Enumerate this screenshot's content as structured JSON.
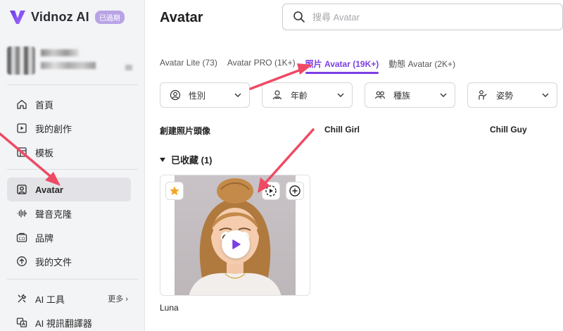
{
  "brand": {
    "name": "Vidnoz AI",
    "badge": "已過期"
  },
  "sidebar": {
    "items": [
      {
        "label": "首頁",
        "icon": "home-icon"
      },
      {
        "label": "我的創作",
        "icon": "play-square-icon"
      },
      {
        "label": "模板",
        "icon": "template-icon"
      },
      {
        "label": "Avatar",
        "icon": "avatar-icon"
      },
      {
        "label": "聲音克隆",
        "icon": "waveform-icon"
      },
      {
        "label": "品牌",
        "icon": "brand-icon"
      },
      {
        "label": "我的文件",
        "icon": "upload-icon"
      },
      {
        "label": "AI 工具",
        "icon": "tools-icon",
        "more": "更多"
      },
      {
        "label": "AI 視訊翻譯器",
        "icon": "translate-icon"
      }
    ]
  },
  "header": {
    "title": "Avatar",
    "search_placeholder": "搜尋 Avatar"
  },
  "tabs": [
    {
      "label": "Avatar Lite (73)"
    },
    {
      "label": "Avatar PRO (1K+)"
    },
    {
      "label": "照片 Avatar (19K+)",
      "active": true
    },
    {
      "label": "動態 Avatar (2K+)"
    }
  ],
  "filters": [
    {
      "label": "性別",
      "icon": "gender-icon"
    },
    {
      "label": "年齡",
      "icon": "age-icon"
    },
    {
      "label": "種族",
      "icon": "ethnicity-icon"
    },
    {
      "label": "姿勢",
      "icon": "pose-icon"
    }
  ],
  "labels": {
    "create": "創建照片頭像",
    "girl": "Chill Girl",
    "guy": "Chill Guy"
  },
  "favorites": {
    "heading": "已收藏 (1)"
  },
  "card": {
    "name": "Luna"
  },
  "colors": {
    "accent": "#7b3fe4",
    "arrow": "#ef4a64",
    "star": "#f5a524"
  }
}
